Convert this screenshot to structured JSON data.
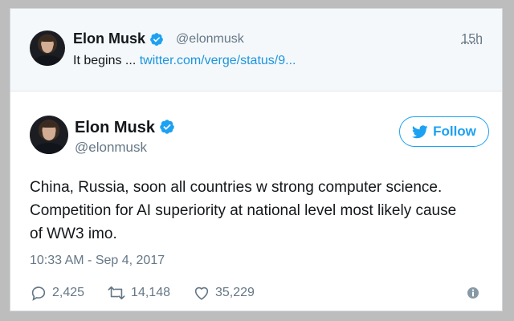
{
  "colors": {
    "accent": "#1da1f2",
    "link": "#1b95e0",
    "muted": "#657786",
    "text": "#14171a",
    "parent_bg": "#f5f8fa"
  },
  "parent_tweet": {
    "name": "Elon Musk",
    "handle": "@elonmusk",
    "time": "15h",
    "text_prefix": "It begins ... ",
    "link_text": "twitter.com/verge/status/9...",
    "avatar_icon": "profile-photo",
    "verified_icon": "verified-badge-icon"
  },
  "main_tweet": {
    "name": "Elon Musk",
    "handle": "@elonmusk",
    "follow_label": "Follow",
    "follow_icon": "twitter-bird-icon",
    "text_lines": [
      "China, Russia, soon all countries w strong computer science.",
      "Competition for AI superiority at national level most likely cause",
      "of WW3 imo."
    ],
    "timestamp": "10:33 AM - Sep 4, 2017",
    "replies": "2,425",
    "retweets": "14,148",
    "likes": "35,229",
    "info_icon": "info-icon"
  }
}
